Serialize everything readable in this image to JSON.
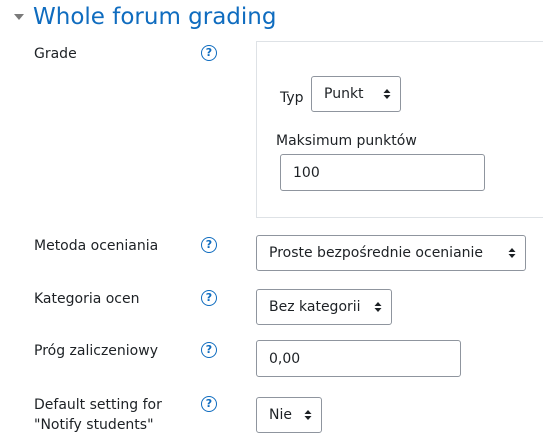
{
  "section": {
    "title": "Whole forum grading"
  },
  "help_glyph": "?",
  "grade": {
    "label": "Grade",
    "type_label": "Typ",
    "type_value": "Punkt",
    "max_label": "Maksimum punktów",
    "max_value": "100"
  },
  "grading_method": {
    "label": "Metoda oceniania",
    "value": "Proste bezpośrednie ocenianie"
  },
  "grade_category": {
    "label": "Kategoria ocen",
    "value": "Bez kategorii"
  },
  "grade_to_pass": {
    "label": "Próg zaliczeniowy",
    "value": "0,00"
  },
  "notify_students": {
    "label_line1": "Default setting for",
    "label_line2": "\"Notify students\"",
    "value": "Nie"
  },
  "colors": {
    "accent": "#0f6cbf",
    "text": "#1d2125",
    "border": "#8f959e",
    "fieldset_border": "#dee2e6"
  }
}
